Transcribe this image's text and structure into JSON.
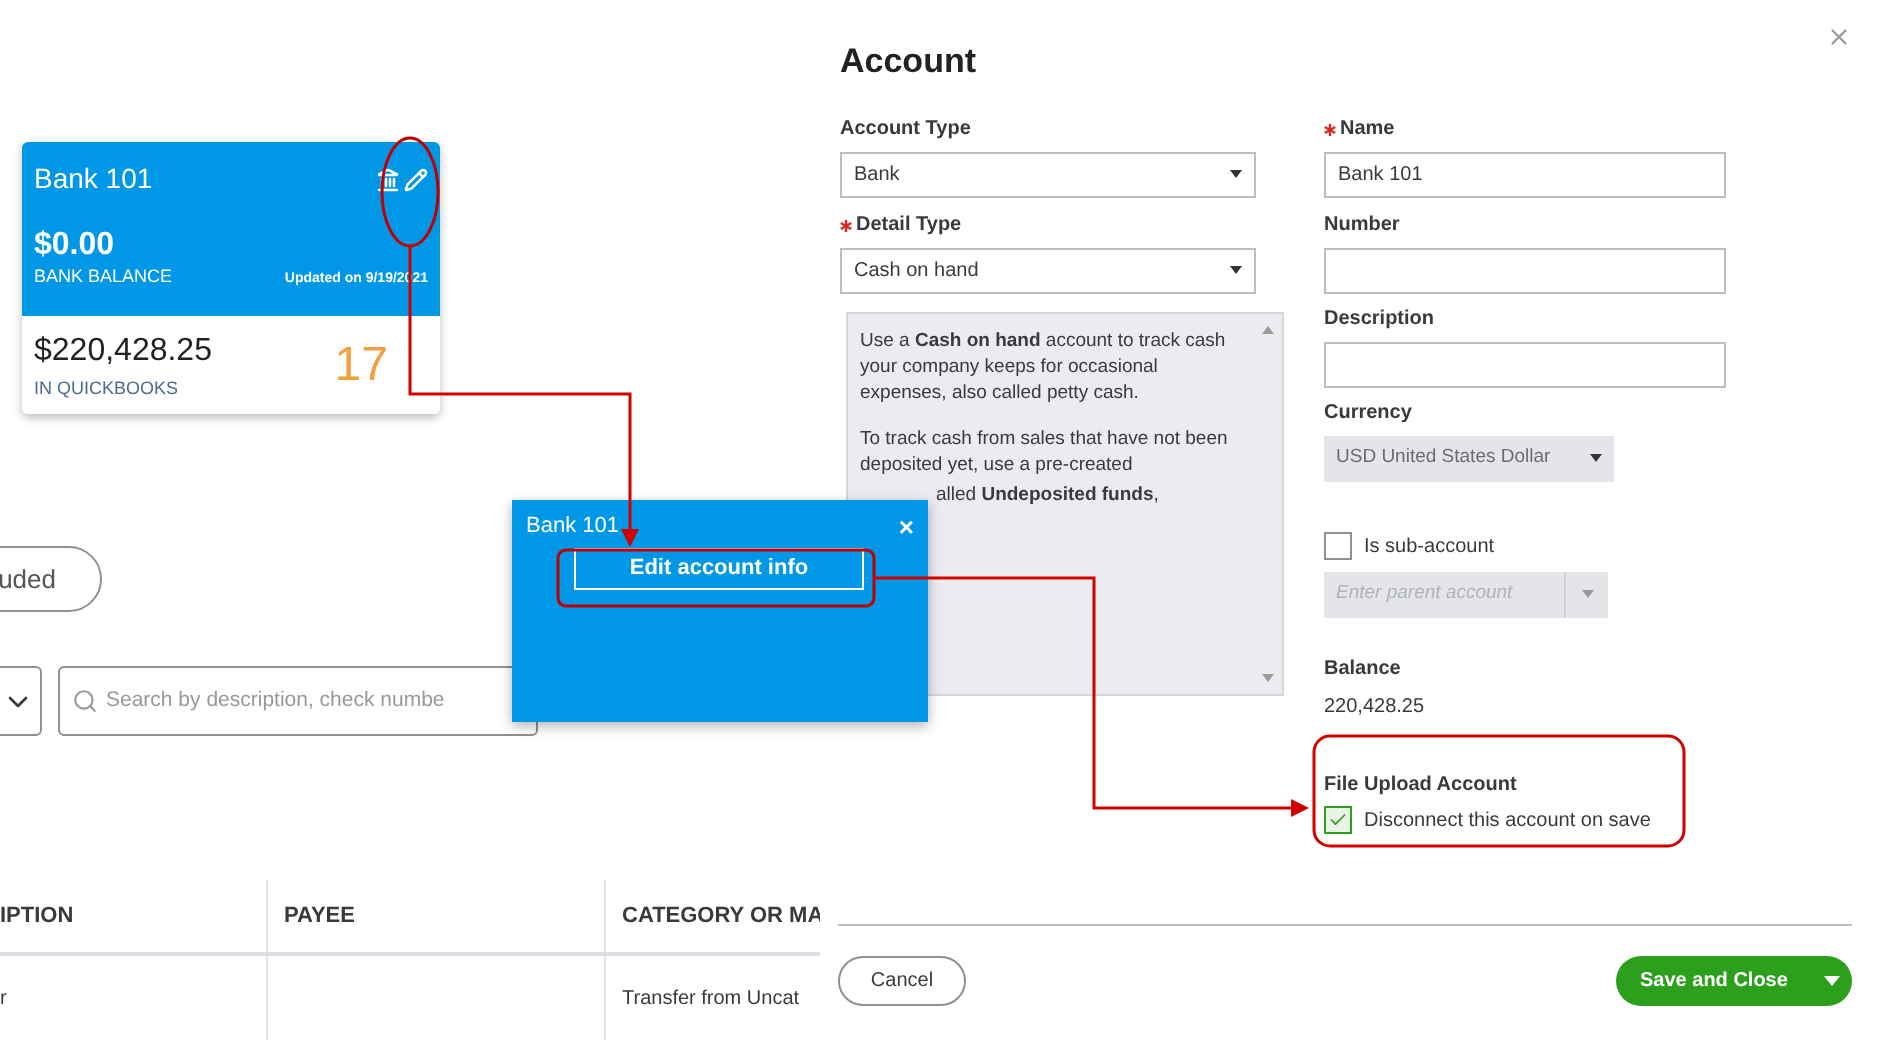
{
  "account_card": {
    "title": "Bank 101",
    "bank_balance": "$0.00",
    "bank_balance_label": "BANK BALANCE",
    "updated": "Updated on 9/19/2021",
    "books_balance": "$220,428.25",
    "books_label": "IN QUICKBOOKS",
    "count": "17"
  },
  "filter_pill": "uded",
  "search": {
    "placeholder": "Search by description, check numbe"
  },
  "table": {
    "columns": [
      "IPTION",
      "PAYEE",
      "CATEGORY OR MA"
    ],
    "rows": [
      {
        "column_1": "r",
        "column_3": "Transfer from Uncat"
      }
    ]
  },
  "popup": {
    "title": "Bank 101",
    "close": "×",
    "button": "Edit account info"
  },
  "panel": {
    "title": "Account",
    "account_type": {
      "label": "Account Type",
      "value": "Bank",
      "required": false
    },
    "detail_type": {
      "label": "Detail Type",
      "value": "Cash on hand",
      "required": true
    },
    "help": [
      "Use a **Cash on hand** account to track cash your company keeps for occasional expenses, also called petty cash.",
      "To track cash from sales that have not been deposited yet, use a pre-created",
      "alled **Undeposited funds**,"
    ],
    "name": {
      "label": "Name",
      "value": "Bank 101",
      "required": true
    },
    "number": {
      "label": "Number",
      "required": false
    },
    "description": {
      "label": "Description",
      "required": false
    },
    "currency": {
      "label": "Currency",
      "value": "USD United States Dollar"
    },
    "sub_account": {
      "label": "Is sub-account",
      "checked": false,
      "placeholder": "Enter parent account"
    },
    "balance": {
      "label": "Balance",
      "value": "220,428.25"
    },
    "file_upload": {
      "label": "File Upload Account",
      "checkbox": "Disconnect this account on save",
      "checked": true
    },
    "cancel": "Cancel",
    "save": "Save and Close"
  }
}
